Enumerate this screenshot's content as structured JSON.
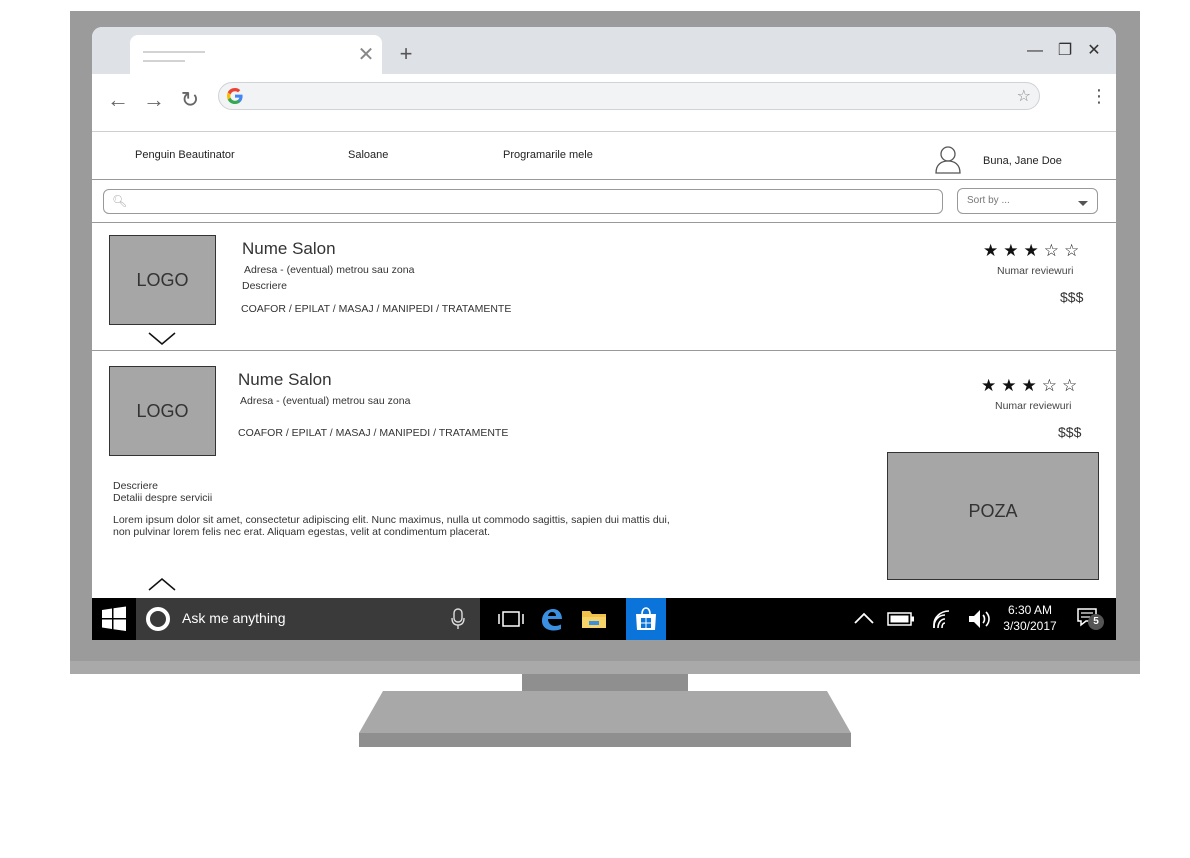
{
  "browser": {
    "new_tab_symbol": "+",
    "close_tab_symbol": "✕",
    "minimize_symbol": "—",
    "restore_symbol": "❐",
    "close_window_symbol": "✕",
    "back_symbol": "←",
    "forward_symbol": "→",
    "reload_symbol": "↻",
    "bookmark_symbol": "☆",
    "menu_symbol": "⋮",
    "address_value": ""
  },
  "nav": {
    "brand": "Penguin Beautinator",
    "saloane": "Saloane",
    "programari": "Programarile mele",
    "greeting": "Buna, Jane Doe"
  },
  "search": {
    "placeholder": "",
    "sort_label": "Sort by ..."
  },
  "salons": [
    {
      "logo": "LOGO",
      "name": "Nume Salon",
      "address": "Adresa - (eventual) metrou sau zona",
      "description": "Descriere",
      "services": "COAFOR /  EPILAT / MASAJ / MANIPEDI / TRATAMENTE",
      "rating": 3,
      "stars": "★★★☆☆",
      "reviews": "Numar reviewuri",
      "price": "$$$",
      "expanded": false
    },
    {
      "logo": "LOGO",
      "name": "Nume Salon",
      "address": "Adresa - (eventual) metrou sau zona",
      "services": "COAFOR /  EPILAT / MASAJ / MANIPEDI / TRATAMENTE",
      "rating": 3,
      "stars": "★★★☆☆",
      "reviews": "Numar reviewuri",
      "price": "$$$",
      "expanded": true,
      "detail_title": "Descriere",
      "detail_subtitle": "Detalii despre servicii",
      "lorem_line1": "Lorem ipsum dolor sit amet, consectetur adipiscing elit. Nunc maximus, nulla ut commodo sagittis, sapien dui mattis dui,",
      "lorem_line2": "non pulvinar lorem felis nec erat. Aliquam egestas, velit at condimentum placerat.",
      "photo": "POZA"
    }
  ],
  "taskbar": {
    "cortana_text": "Ask me anything",
    "time": "6:30 AM",
    "date": "3/30/2017",
    "notifications": "5",
    "icons": [
      "windows-start-icon",
      "cortana-icon",
      "microphone-icon",
      "task-view-icon",
      "edge-icon",
      "file-explorer-icon",
      "store-icon",
      "chevron-up-icon",
      "battery-icon",
      "wifi-icon",
      "volume-icon",
      "action-center-icon"
    ]
  },
  "colors": {
    "taskbar": "#000000",
    "cortana_bg": "#3a3a3a",
    "store_active": "#0a74da",
    "placeholder_gray": "#a6a6a6",
    "monitor_frame": "#9b9b9b",
    "tab_strip": "#dee1e6"
  }
}
